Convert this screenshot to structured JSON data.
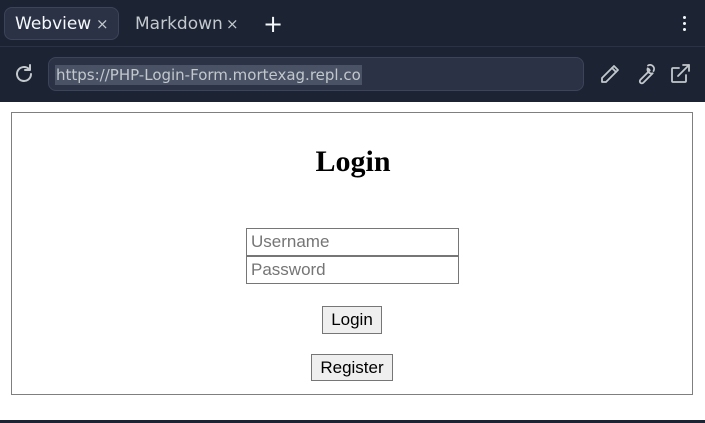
{
  "tabs": [
    {
      "label": "Webview",
      "active": true
    },
    {
      "label": "Markdown",
      "active": false
    }
  ],
  "tab_close_glyph": "×",
  "new_tab_glyph": "+",
  "toolbar": {
    "url": "https://PHP-Login-Form.mortexag.repl.co",
    "icons": [
      "reload-icon",
      "pencil-icon",
      "wrench-icon",
      "open-external-icon",
      "kebab-menu-icon"
    ]
  },
  "page": {
    "title": "Login",
    "username_placeholder": "Username",
    "password_placeholder": "Password",
    "login_label": "Login",
    "register_label": "Register"
  },
  "colors": {
    "chrome_bg": "#1c2333",
    "tab_active_bg": "#2b3245",
    "url_selection": "#4a5266",
    "page_bg": "#ffffff"
  }
}
